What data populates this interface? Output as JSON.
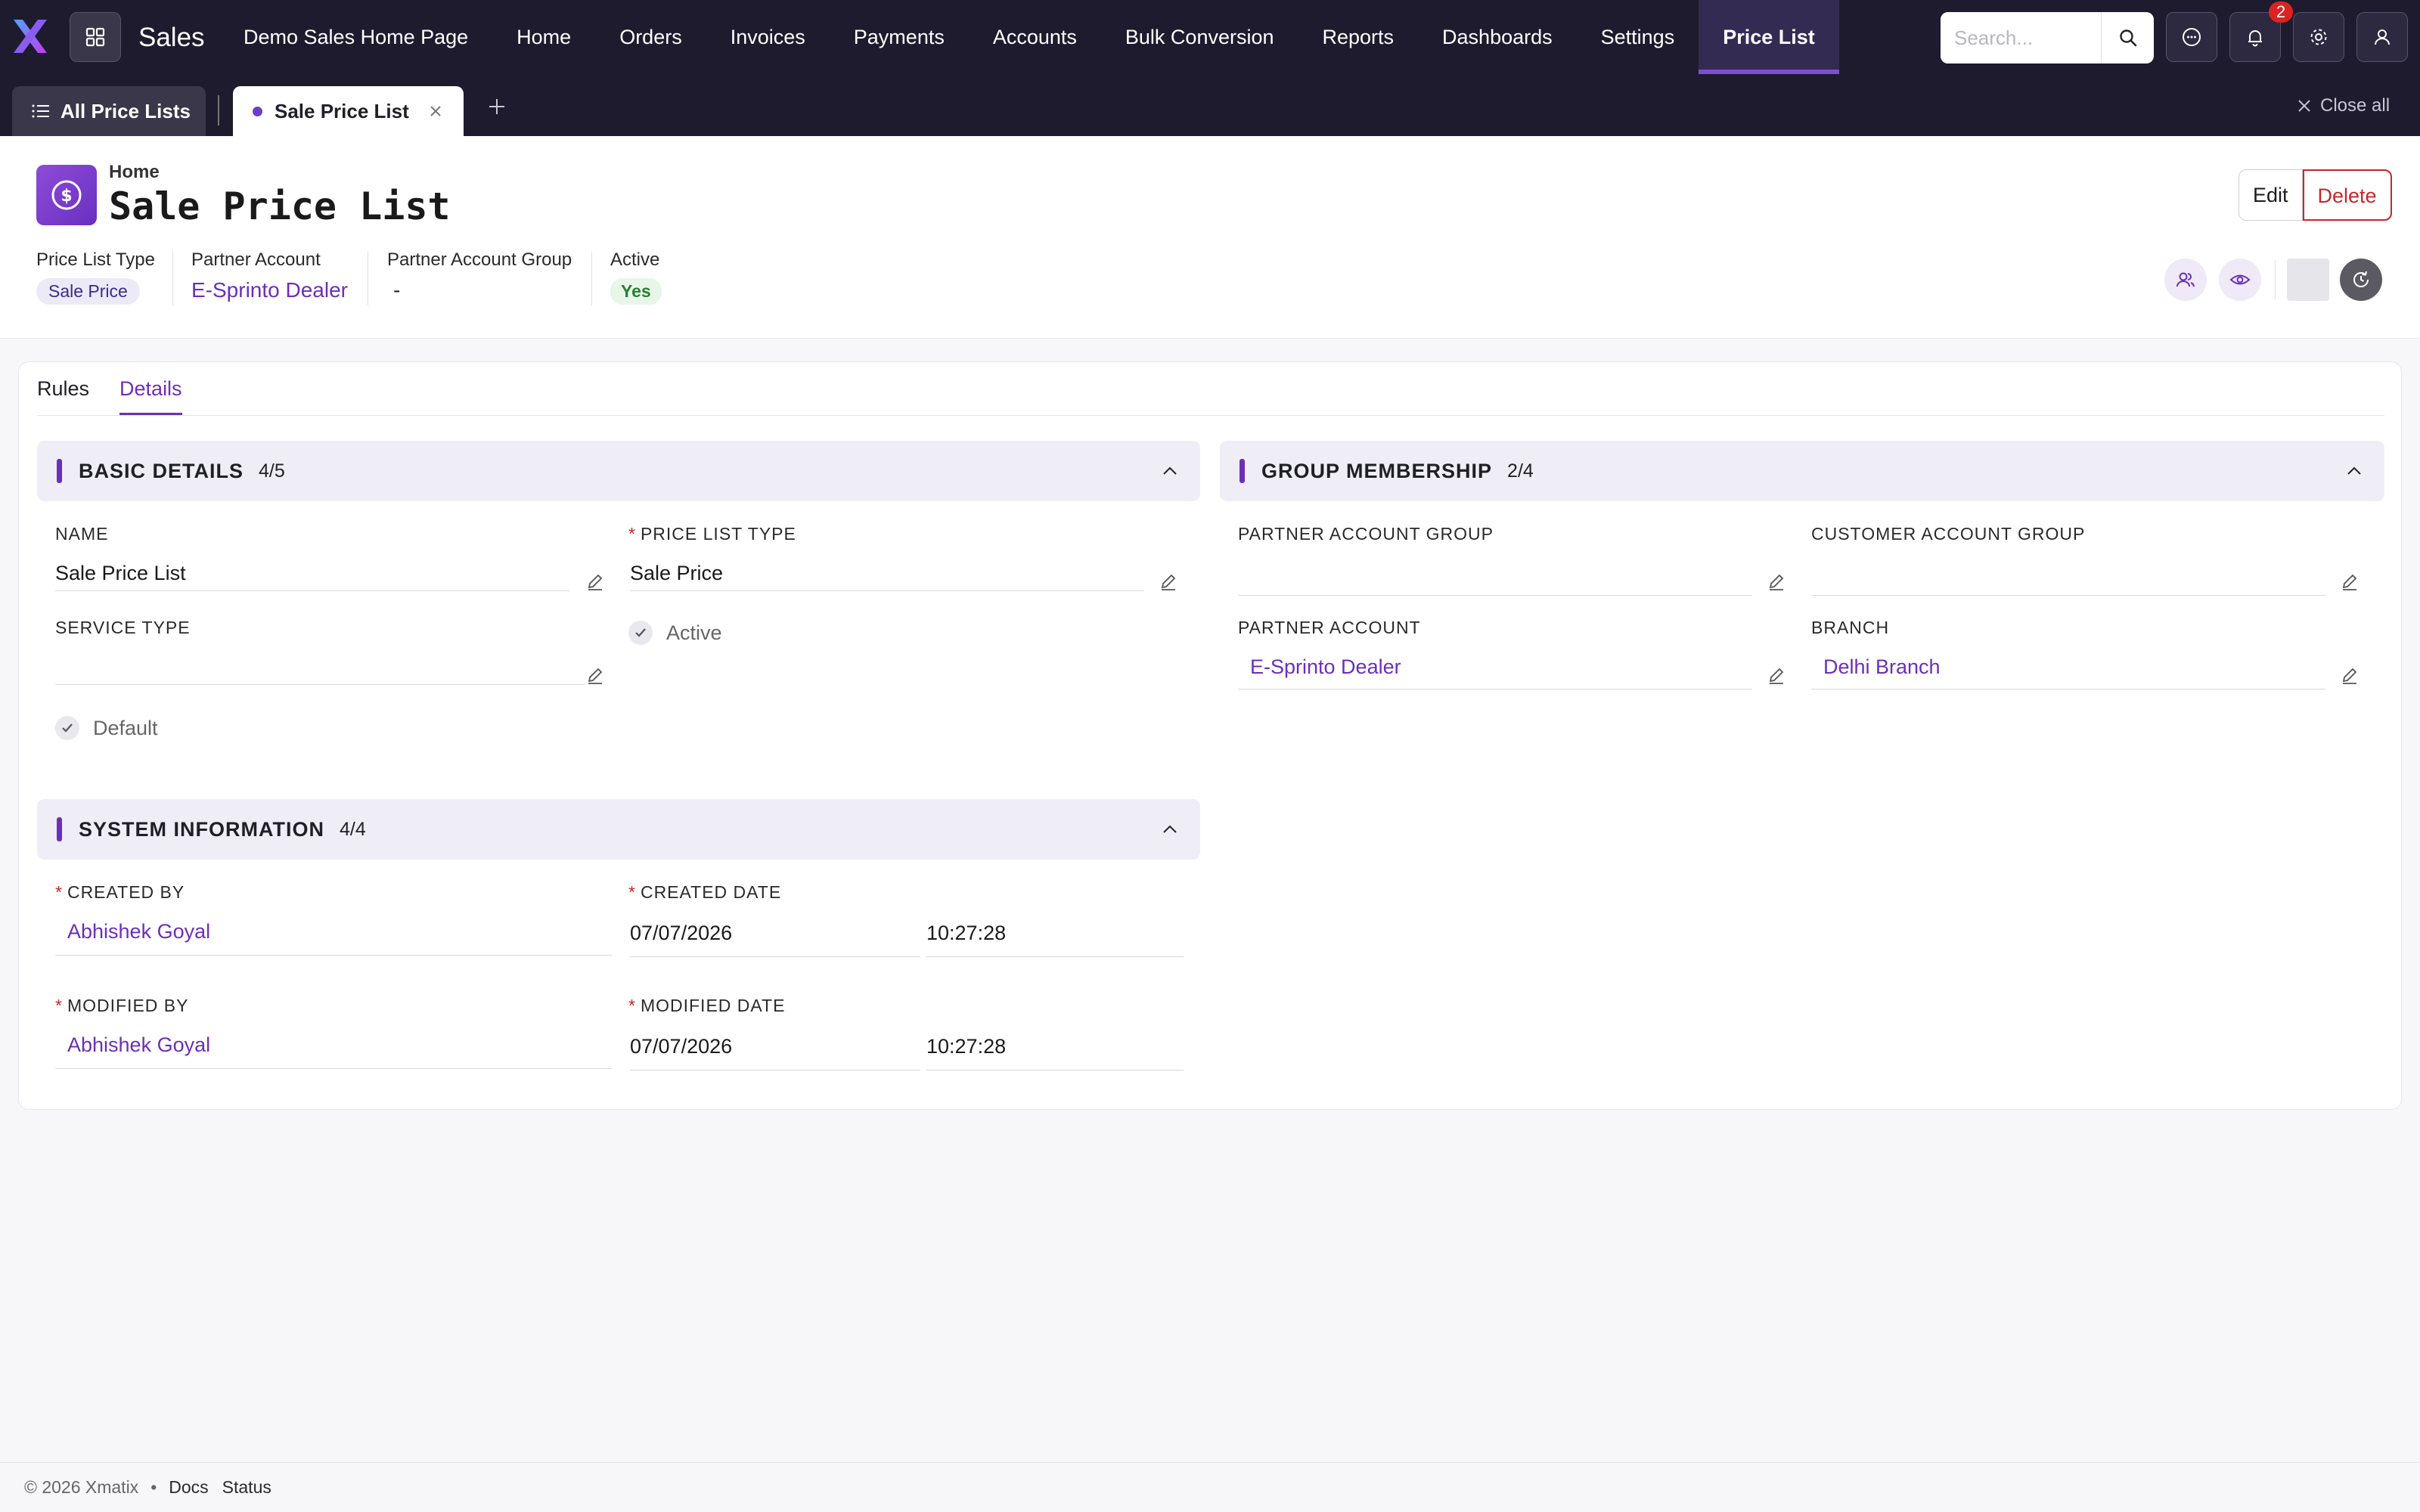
{
  "app": {
    "name": "Sales"
  },
  "nav": {
    "links": [
      "Demo Sales Home Page",
      "Home",
      "Orders",
      "Invoices",
      "Payments",
      "Accounts",
      "Bulk Conversion",
      "Reports",
      "Dashboards",
      "Settings",
      "Price List"
    ],
    "active": "Price List",
    "search_placeholder": "Search...",
    "notification_count": "2"
  },
  "tabs": {
    "all": "All Price Lists",
    "current": "Sale Price List",
    "close_all": "Close all"
  },
  "header": {
    "breadcrumb": "Home",
    "title": "Sale Price List",
    "edit_label": "Edit",
    "delete_label": "Delete",
    "meta": [
      {
        "label": "Price List Type",
        "value": "Sale Price"
      },
      {
        "label": "Partner Account",
        "value": "E-Sprinto Dealer"
      },
      {
        "label": "Partner Account Group",
        "value": "-"
      },
      {
        "label": "Active",
        "value": "Yes"
      }
    ]
  },
  "detail_tabs": [
    "Rules",
    "Details"
  ],
  "active_detail_tab": "Details",
  "basic": {
    "title": "BASIC DETAILS",
    "count": "4/5",
    "name_label": "NAME",
    "name_value": "Sale Price List",
    "plt_label": "PRICE LIST TYPE",
    "plt_value": "Sale Price",
    "service_label": "SERVICE TYPE",
    "service_value": "",
    "active_label": "Active",
    "default_label": "Default"
  },
  "group": {
    "title": "GROUP MEMBERSHIP",
    "count": "2/4",
    "pag_label": "PARTNER ACCOUNT GROUP",
    "pag_value": "",
    "cag_label": "CUSTOMER ACCOUNT GROUP",
    "cag_value": "",
    "pa_label": "PARTNER ACCOUNT",
    "pa_value": "E-Sprinto Dealer",
    "branch_label": "BRANCH",
    "branch_value": "Delhi Branch"
  },
  "system": {
    "title": "SYSTEM INFORMATION",
    "count": "4/4",
    "created_by_label": "CREATED BY",
    "created_by": "Abhishek Goyal",
    "created_date_label": "CREATED DATE",
    "created_date": "07/07/2026",
    "created_time": "10:27:28",
    "modified_by_label": "MODIFIED BY",
    "modified_by": "Abhishek Goyal",
    "modified_date_label": "MODIFIED DATE",
    "modified_date": "07/07/2026",
    "modified_time": "10:27:28"
  },
  "footer": {
    "copyright": "© 2026 Xmatix",
    "bullet": "•",
    "docs": "Docs",
    "status": "Status"
  },
  "colors": {
    "accent": "#6b2fb8",
    "nav_bg": "#1e1b2e",
    "danger": "#c62828",
    "success": "#2a7f32"
  }
}
